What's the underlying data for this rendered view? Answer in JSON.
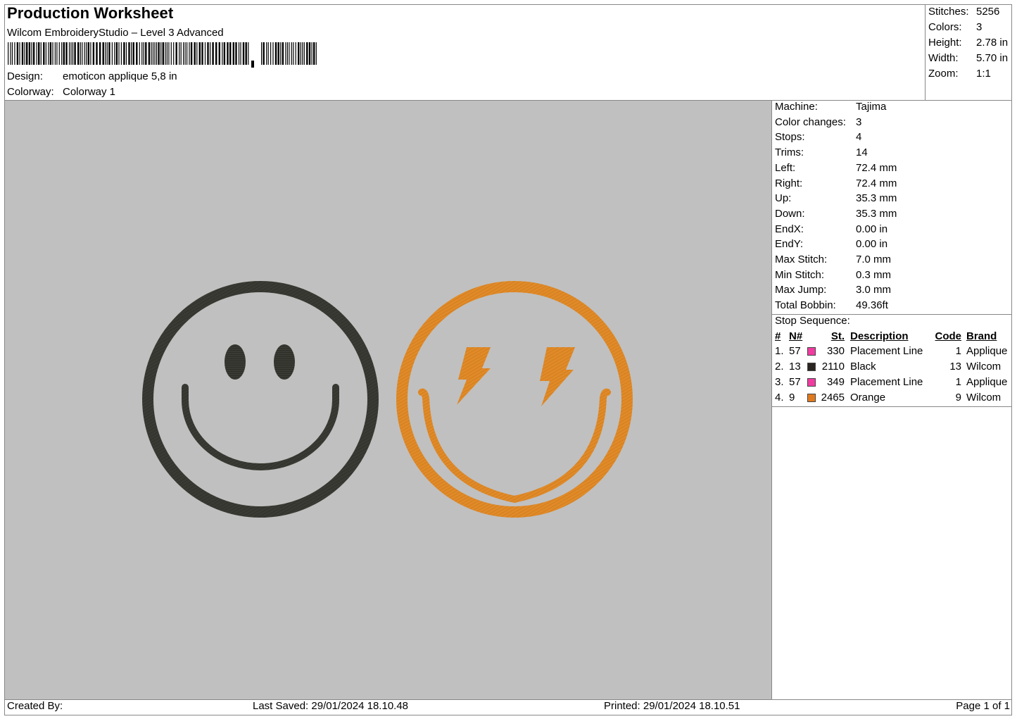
{
  "header": {
    "title": "Production Worksheet",
    "subtitle": "Wilcom EmbroideryStudio – Level 3 Advanced",
    "design_label": "Design:",
    "design_value": "emoticon applique 5,8 in",
    "colorway_label": "Colorway:",
    "colorway_value": "Colorway 1"
  },
  "summary": [
    {
      "label": "Stitches:",
      "value": "5256"
    },
    {
      "label": "Colors:",
      "value": "3"
    },
    {
      "label": "Height:",
      "value": "2.78 in"
    },
    {
      "label": "Width:",
      "value": "5.70 in"
    },
    {
      "label": "Zoom:",
      "value": "1:1"
    }
  ],
  "machine_info": [
    {
      "label": "Machine:",
      "value": "Tajima"
    },
    {
      "label": "Color changes:",
      "value": "3"
    },
    {
      "label": "Stops:",
      "value": "4"
    },
    {
      "label": "Trims:",
      "value": "14"
    },
    {
      "label": "Left:",
      "value": "72.4 mm"
    },
    {
      "label": "Right:",
      "value": "72.4 mm"
    },
    {
      "label": "Up:",
      "value": "35.3 mm"
    },
    {
      "label": "Down:",
      "value": "35.3 mm"
    },
    {
      "label": "EndX:",
      "value": "0.00 in"
    },
    {
      "label": "EndY:",
      "value": "0.00 in"
    },
    {
      "label": "Max Stitch:",
      "value": "7.0 mm"
    },
    {
      "label": "Min Stitch:",
      "value": "0.3 mm"
    },
    {
      "label": "Max Jump:",
      "value": "3.0 mm"
    },
    {
      "label": "Total Bobbin:",
      "value": "49.36ft"
    }
  ],
  "stop_sequence": {
    "title": "Stop Sequence:",
    "columns": [
      "#",
      "N#",
      "St.",
      "Description",
      "Code",
      "Brand"
    ],
    "rows": [
      {
        "idx": "1.",
        "n": "57",
        "color": "#f03ca0",
        "st": "330",
        "desc": "Placement Line",
        "code": "1",
        "brand": "Applique"
      },
      {
        "idx": "2.",
        "n": "13",
        "color": "#2a2520",
        "st": "2110",
        "desc": "Black",
        "code": "13",
        "brand": "Wilcom"
      },
      {
        "idx": "3.",
        "n": "57",
        "color": "#f03ca0",
        "st": "349",
        "desc": "Placement Line",
        "code": "1",
        "brand": "Applique"
      },
      {
        "idx": "4.",
        "n": "9",
        "color": "#e07a1e",
        "st": "2465",
        "desc": "Orange",
        "code": "9",
        "brand": "Wilcom"
      }
    ]
  },
  "design_colors": {
    "background": "#c0c0c0",
    "black_thread": "#3a3a34",
    "orange_thread": "#e08a28"
  },
  "footer": {
    "created_by": "Created By:",
    "last_saved": "Last Saved: 29/01/2024 18.10.48",
    "printed": "Printed: 29/01/2024 18.10.51",
    "page": "Page 1 of 1"
  }
}
